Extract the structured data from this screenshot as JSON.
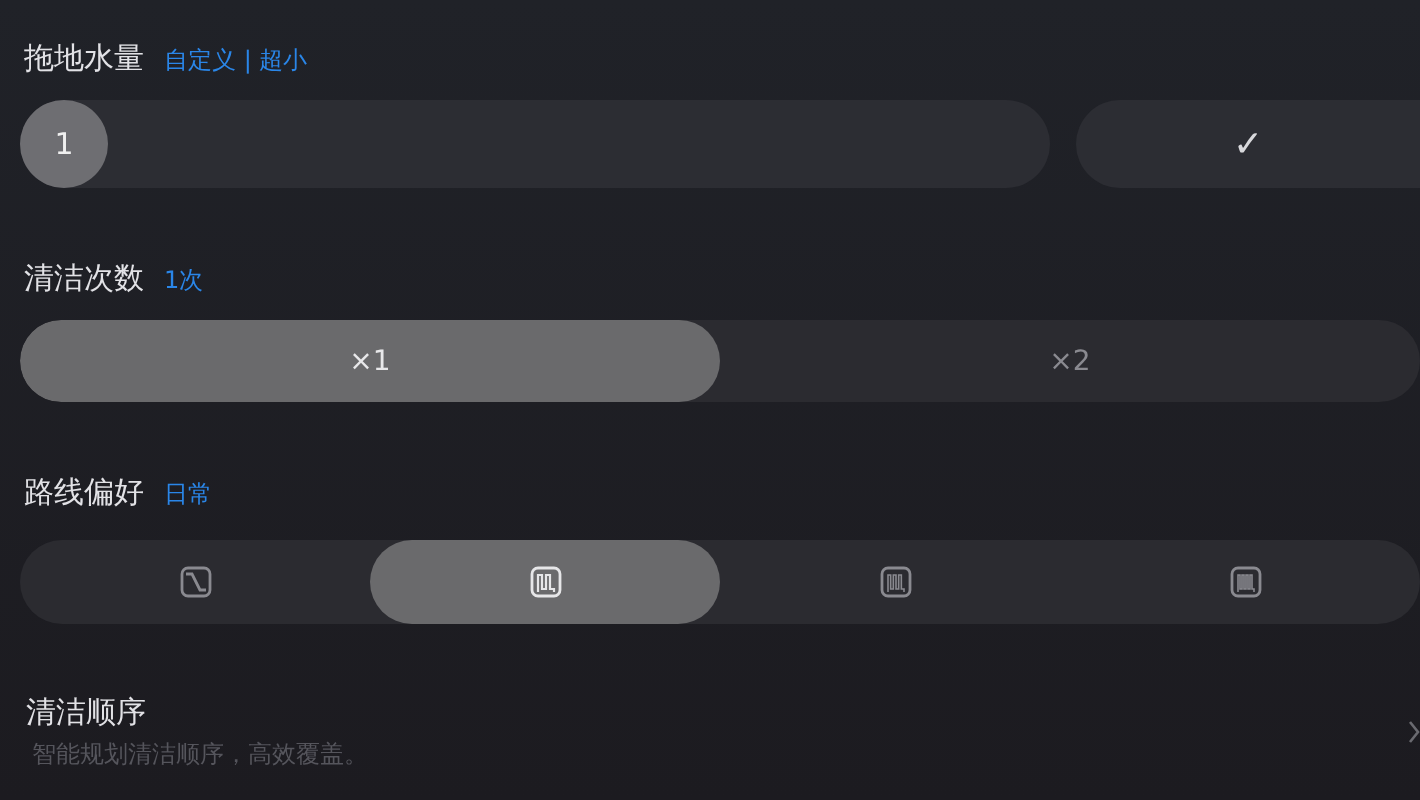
{
  "mop_water": {
    "title": "拖地水量",
    "value": "自定义 | 超小",
    "slider": {
      "reading": "1",
      "level": 0
    },
    "confirm": {
      "symbol": "✓"
    }
  },
  "clean_times": {
    "title": "清洁次数",
    "value": "1次",
    "options": [
      {
        "label": "×1",
        "selected": true
      },
      {
        "label": "×2",
        "selected": false
      }
    ]
  },
  "route": {
    "title": "路线偏好",
    "value": "日常",
    "options": [
      {
        "kind": "diagonal",
        "selected": false
      },
      {
        "kind": "double",
        "selected": true
      },
      {
        "kind": "triple",
        "selected": false
      },
      {
        "kind": "quad",
        "selected": false
      }
    ]
  },
  "order": {
    "title": "清洁顺序",
    "subtitle": "智能规划清洁顺序，高效覆盖。"
  }
}
